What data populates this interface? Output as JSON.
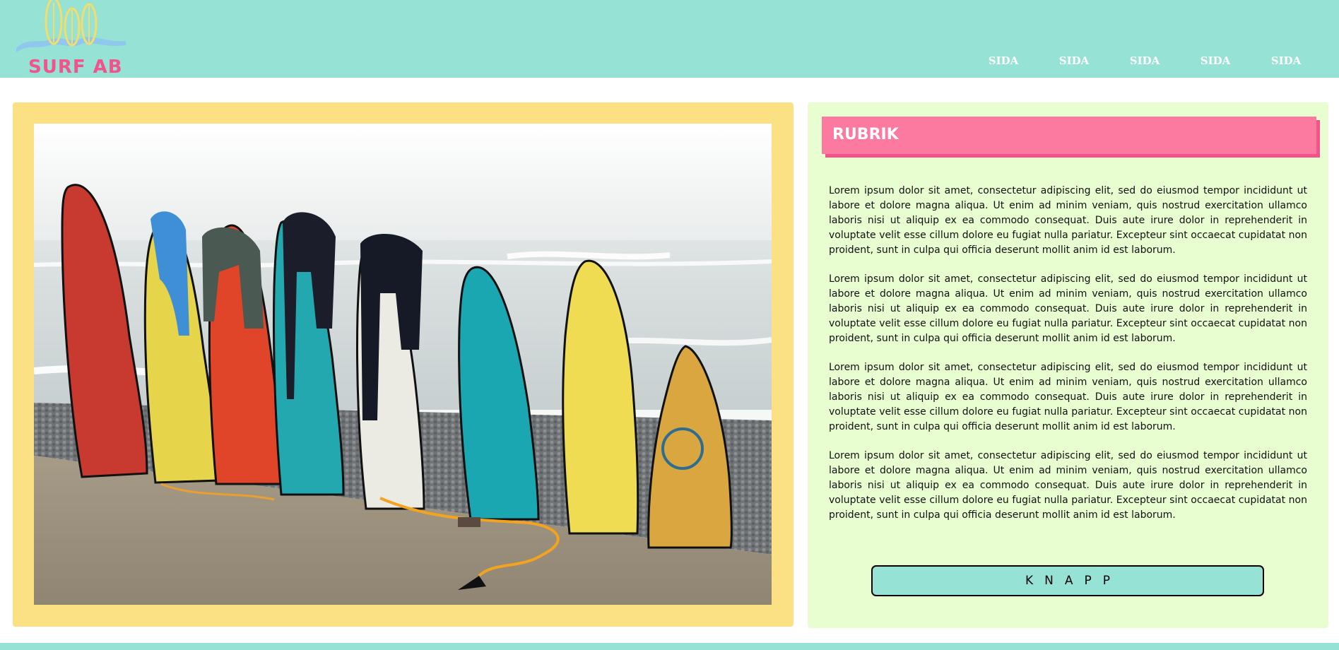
{
  "logo": {
    "text": "SURF AB"
  },
  "nav": {
    "items": [
      "SIDA",
      "SIDA",
      "SIDA",
      "SIDA",
      "SIDA"
    ]
  },
  "photo": {
    "subject": "surfboards-on-beach"
  },
  "panel": {
    "heading": "RUBRIK",
    "paragraphs": [
      "Lorem ipsum dolor sit amet, consectetur adipiscing elit, sed do eiusmod tempor incididunt ut labore et dolore magna aliqua. Ut enim ad minim veniam, quis nostrud exercitation ullamco laboris nisi ut aliquip ex ea commodo consequat. Duis aute irure dolor in reprehenderit in voluptate velit esse cillum dolore eu fugiat nulla pariatur. Excepteur sint occaecat cupidatat non proident, sunt in culpa qui officia deserunt mollit anim id est laborum.",
      "Lorem ipsum dolor sit amet, consectetur adipiscing elit, sed do eiusmod tempor incididunt ut labore et dolore magna aliqua. Ut enim ad minim veniam, quis nostrud exercitation ullamco laboris nisi ut aliquip ex ea commodo consequat. Duis aute irure dolor in reprehenderit in voluptate velit esse cillum dolore eu fugiat nulla pariatur. Excepteur sint occaecat cupidatat non proident, sunt in culpa qui officia deserunt mollit anim id est laborum.",
      "Lorem ipsum dolor sit amet, consectetur adipiscing elit, sed do eiusmod tempor incididunt ut labore et dolore magna aliqua. Ut enim ad minim veniam, quis nostrud exercitation ullamco laboris nisi ut aliquip ex ea commodo consequat. Duis aute irure dolor in reprehenderit in voluptate velit esse cillum dolore eu fugiat nulla pariatur. Excepteur sint occaecat cupidatat non proident, sunt in culpa qui officia deserunt mollit anim id est laborum.",
      "Lorem ipsum dolor sit amet, consectetur adipiscing elit, sed do eiusmod tempor incididunt ut labore et dolore magna aliqua. Ut enim ad minim veniam, quis nostrud exercitation ullamco laboris nisi ut aliquip ex ea commodo consequat. Duis aute irure dolor in reprehenderit in voluptate velit esse cillum dolore eu fugiat nulla pariatur. Excepteur sint occaecat cupidatat non proident, sunt in culpa qui officia deserunt mollit anim id est laborum."
    ],
    "button_label": "KNAPP"
  },
  "colors": {
    "header": "#96e2d5",
    "logo_text": "#f2538b",
    "photo_frame": "#fbe184",
    "panel_bg": "#e8fdd0",
    "heading_bg": "#fc79a0",
    "button_bg": "#96e2d5"
  }
}
